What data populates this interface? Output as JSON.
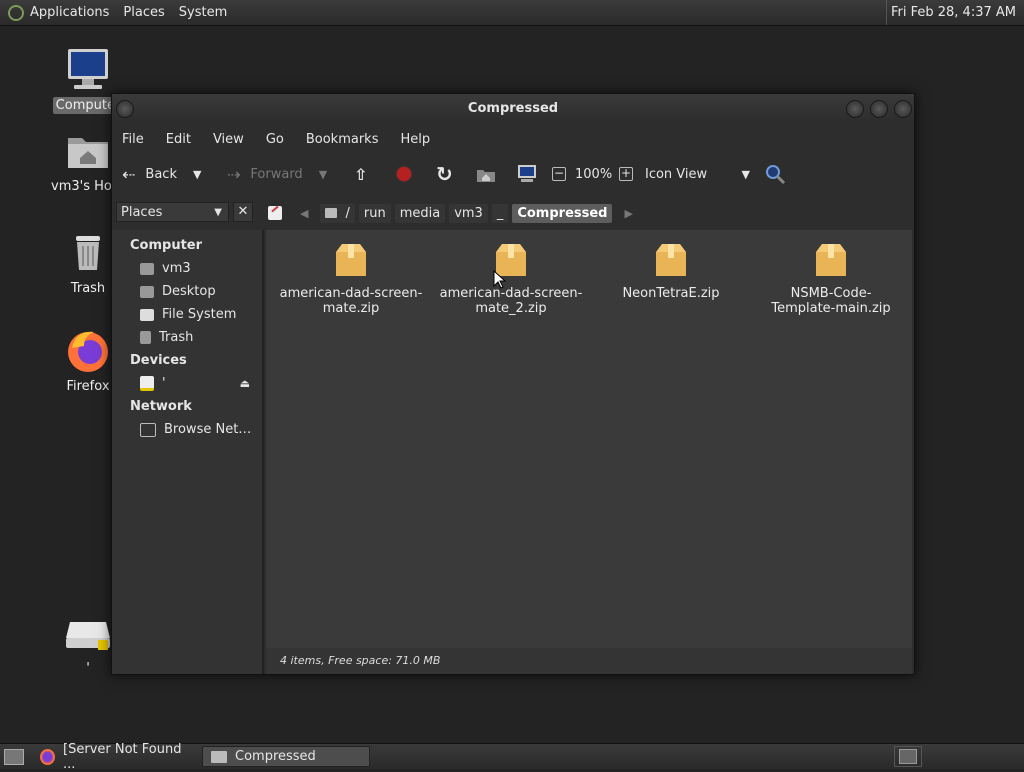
{
  "top_panel": {
    "menus": [
      "Applications",
      "Places",
      "System"
    ],
    "clock": "Fri Feb 28,  4:37 AM"
  },
  "desktop_icons": [
    {
      "label": "Computer",
      "icon": "computer-icon",
      "selected": true
    },
    {
      "label": "vm3's Home",
      "icon": "home-folder-icon"
    },
    {
      "label": "Trash",
      "icon": "trash-icon"
    },
    {
      "label": "Firefox",
      "icon": "firefox-icon"
    },
    {
      "label": "'",
      "icon": "drive-icon"
    }
  ],
  "window": {
    "title": "Compressed",
    "menubar": [
      "File",
      "Edit",
      "View",
      "Go",
      "Bookmarks",
      "Help"
    ],
    "toolbar": {
      "back": "Back",
      "forward": "Forward",
      "zoom": "100%",
      "view_mode": "Icon View"
    },
    "places_combo": "Places",
    "breadcrumbs": [
      "/",
      "run",
      "media",
      "vm3",
      "_",
      "Compressed"
    ],
    "sidebar": {
      "sections": [
        {
          "title": "Computer",
          "items": [
            {
              "label": "vm3",
              "icon": "home-icon"
            },
            {
              "label": "Desktop",
              "icon": "desktop-icon"
            },
            {
              "label": "File System",
              "icon": "filesystem-icon"
            },
            {
              "label": "Trash",
              "icon": "trash-icon"
            }
          ]
        },
        {
          "title": "Devices",
          "items": [
            {
              "label": "'",
              "icon": "drive-icon",
              "eject": true
            }
          ]
        },
        {
          "title": "Network",
          "items": [
            {
              "label": "Browse Net…",
              "icon": "network-icon"
            }
          ]
        }
      ]
    },
    "files": [
      {
        "name": "american-dad-screen-mate.zip",
        "line1": "american-dad-screen-",
        "line2": "mate.zip"
      },
      {
        "name": "american-dad-screen-mate_2.zip",
        "line1": "american-dad-screen-",
        "line2": "mate_2.zip"
      },
      {
        "name": "NeonTetraE.zip",
        "line1": "NeonTetraE.zip",
        "line2": ""
      },
      {
        "name": "NSMB-Code-Template-main.zip",
        "line1": "NSMB-Code-",
        "line2": "Template-main.zip"
      }
    ],
    "status": "4 items, Free space: 71.0 MB"
  },
  "taskbar": {
    "tasks": [
      {
        "label": "[Server Not Found ...",
        "icon": "firefox-icon"
      },
      {
        "label": "Compressed",
        "icon": "folder-icon",
        "active": true
      }
    ]
  },
  "colors": {
    "zip_folder": "#e9b455",
    "accent_red": "#c0392b"
  }
}
